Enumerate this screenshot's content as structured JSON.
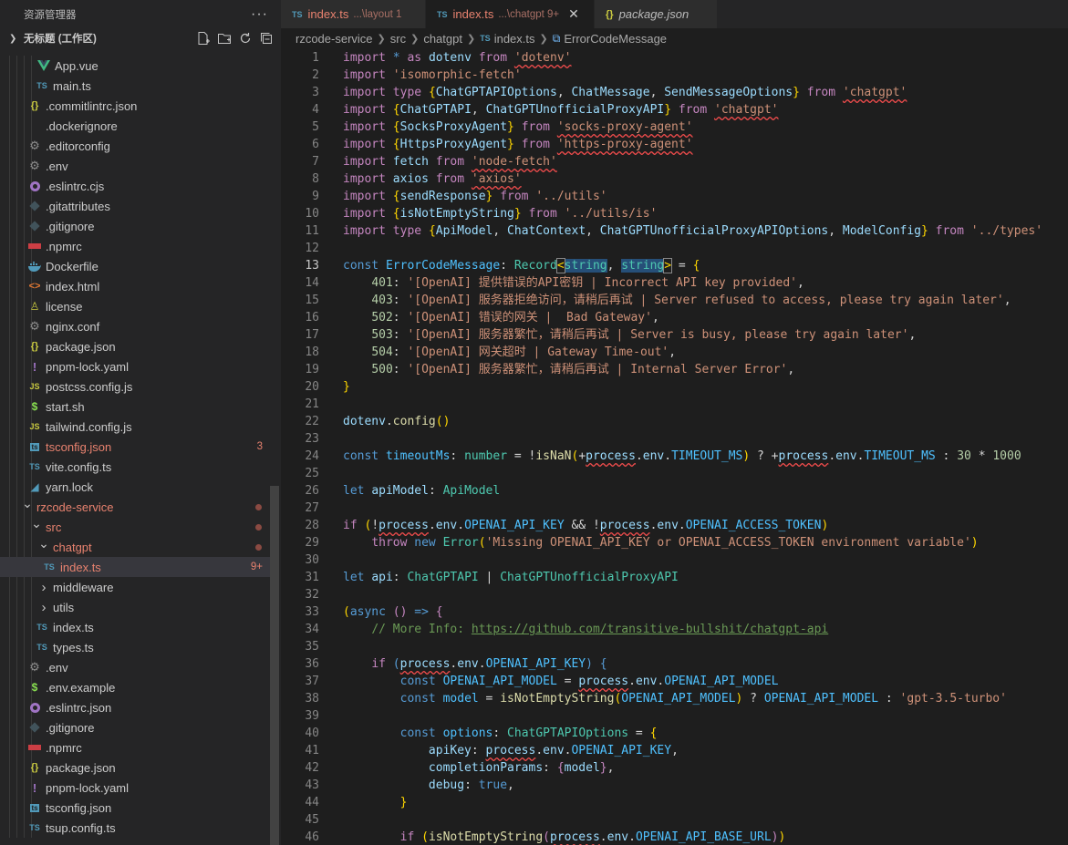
{
  "sidebar": {
    "header": "资源管理器",
    "more": "···",
    "workspace": "无标题 (工作区)",
    "items": [
      {
        "label": "App.vue",
        "icon": "vue",
        "color": "#41b883",
        "indent": 40
      },
      {
        "label": "main.ts",
        "icon": "ts",
        "color": "#519aba",
        "indent": 38
      },
      {
        "label": ".commitlintrc.json",
        "icon": "json",
        "color": "#cbcb41",
        "indent": 30
      },
      {
        "label": ".dockerignore",
        "icon": "none",
        "color": "#6d8086",
        "indent": 30
      },
      {
        "label": ".editorconfig",
        "icon": "gear",
        "color": "#8d8d8d",
        "indent": 30
      },
      {
        "label": ".env",
        "icon": "gear",
        "color": "#8d8d8d",
        "indent": 30
      },
      {
        "label": ".eslintrc.cjs",
        "icon": "circle",
        "color": "#a074c4",
        "indent": 30
      },
      {
        "label": ".gitattributes",
        "icon": "diamond",
        "color": "#41535b",
        "indent": 30
      },
      {
        "label": ".gitignore",
        "icon": "diamond",
        "color": "#41535b",
        "indent": 30
      },
      {
        "label": ".npmrc",
        "icon": "npm",
        "color": "#cc3e44",
        "indent": 30
      },
      {
        "label": "Dockerfile",
        "icon": "docker",
        "color": "#519aba",
        "indent": 30
      },
      {
        "label": "index.html",
        "icon": "html",
        "color": "#e37933",
        "indent": 30
      },
      {
        "label": "license",
        "icon": "license",
        "color": "#cbcb41",
        "indent": 30
      },
      {
        "label": "nginx.conf",
        "icon": "gear",
        "color": "#8d8d8d",
        "indent": 30
      },
      {
        "label": "package.json",
        "icon": "json",
        "color": "#cbcb41",
        "indent": 30
      },
      {
        "label": "pnpm-lock.yaml",
        "icon": "yaml",
        "color": "#a074c4",
        "indent": 30
      },
      {
        "label": "postcss.config.js",
        "icon": "js",
        "color": "#cbcb41",
        "indent": 30
      },
      {
        "label": "start.sh",
        "icon": "sh",
        "color": "#4d5a5e",
        "indent": 30
      },
      {
        "label": "tailwind.config.js",
        "icon": "js",
        "color": "#cbcb41",
        "indent": 30
      },
      {
        "label": "tsconfig.json",
        "icon": "tsconfig",
        "color": "#519aba",
        "indent": 30,
        "modified": true,
        "badge": "3"
      },
      {
        "label": "vite.config.ts",
        "icon": "ts",
        "color": "#519aba",
        "indent": 30
      },
      {
        "label": "yarn.lock",
        "icon": "yarn",
        "color": "#519aba",
        "indent": 30
      },
      {
        "label": "rzcode-service",
        "icon": "chevron-down",
        "indent": 22,
        "folder": true,
        "modified": true,
        "dot": true
      },
      {
        "label": "src",
        "icon": "chevron-down",
        "indent": 32,
        "folder": true,
        "modified": true,
        "dot": true
      },
      {
        "label": "chatgpt",
        "icon": "chevron-down",
        "indent": 40,
        "folder": true,
        "modified": true,
        "dot": true
      },
      {
        "label": "index.ts",
        "icon": "ts",
        "color": "#519aba",
        "indent": 46,
        "modified": true,
        "badge": "9+",
        "selected": true
      },
      {
        "label": "middleware",
        "icon": "chevron-right",
        "indent": 40,
        "folder": true
      },
      {
        "label": "utils",
        "icon": "chevron-right",
        "indent": 40,
        "folder": true
      },
      {
        "label": "index.ts",
        "icon": "ts",
        "color": "#519aba",
        "indent": 38
      },
      {
        "label": "types.ts",
        "icon": "ts",
        "color": "#519aba",
        "indent": 38
      },
      {
        "label": ".env",
        "icon": "gear",
        "color": "#8d8d8d",
        "indent": 30
      },
      {
        "label": ".env.example",
        "icon": "dollar",
        "color": "#89e051",
        "indent": 30
      },
      {
        "label": ".eslintrc.json",
        "icon": "circle",
        "color": "#a074c4",
        "indent": 30
      },
      {
        "label": ".gitignore",
        "icon": "diamond",
        "color": "#41535b",
        "indent": 30
      },
      {
        "label": ".npmrc",
        "icon": "npm",
        "color": "#cc3e44",
        "indent": 30
      },
      {
        "label": "package.json",
        "icon": "json",
        "color": "#cbcb41",
        "indent": 30
      },
      {
        "label": "pnpm-lock.yaml",
        "icon": "yaml",
        "color": "#a074c4",
        "indent": 30
      },
      {
        "label": "tsconfig.json",
        "icon": "tsconfig",
        "color": "#519aba",
        "indent": 30
      },
      {
        "label": "tsup.config.ts",
        "icon": "ts",
        "color": "#519aba",
        "indent": 30
      }
    ]
  },
  "tabs": [
    {
      "name": "index.ts",
      "desc": "...\\layout 1",
      "icon": "ts",
      "active": false
    },
    {
      "name": "index.ts",
      "desc": "...\\chatgpt 9+",
      "icon": "ts",
      "active": true,
      "close": "✕"
    },
    {
      "name": "package.json",
      "desc": "",
      "icon": "json",
      "active": false,
      "italic": true
    }
  ],
  "breadcrumb": [
    "rzcode-service",
    "src",
    "chatgpt",
    "index.ts",
    "ErrorCodeMessage"
  ],
  "editor": {
    "current_line": 13,
    "first_line": 1,
    "lines": [
      "<span class=\"c\">import</span> <span class=\"k\">*</span> <span class=\"c\">as</span> <span class=\"v\">dotenv</span> <span class=\"c\">from</span> <span class=\"s sq\">'dotenv'</span>",
      "<span class=\"c\">import</span> <span class=\"s\">'isomorphic-fetch'</span>",
      "<span class=\"c\">import</span> <span class=\"c\">type</span> <span class=\"br\">{</span><span class=\"v\">ChatGPTAPIOptions</span>, <span class=\"v\">ChatMessage</span>, <span class=\"v\">SendMessageOptions</span><span class=\"br\">}</span> <span class=\"c\">from</span> <span class=\"s sq\">'chatgpt'</span>",
      "<span class=\"c\">import</span> <span class=\"br\">{</span><span class=\"v\">ChatGPTAPI</span>, <span class=\"v\">ChatGPTUnofficialProxyAPI</span><span class=\"br\">}</span> <span class=\"c\">from</span> <span class=\"s sq\">'chatgpt'</span>",
      "<span class=\"c\">import</span> <span class=\"br\">{</span><span class=\"v\">SocksProxyAgent</span><span class=\"br\">}</span> <span class=\"c\">from</span> <span class=\"s sq\">'socks-proxy-agent'</span>",
      "<span class=\"c\">import</span> <span class=\"br\">{</span><span class=\"v\">HttpsProxyAgent</span><span class=\"br\">}</span> <span class=\"c\">from</span> <span class=\"s sq\">'https-proxy-agent'</span>",
      "<span class=\"c\">import</span> <span class=\"v\">fetch</span> <span class=\"c\">from</span> <span class=\"s sq\">'node-fetch'</span>",
      "<span class=\"c\">import</span> <span class=\"v\">axios</span> <span class=\"c\">from</span> <span class=\"s sq\">'axios'</span>",
      "<span class=\"c\">import</span> <span class=\"br\">{</span><span class=\"v\">sendResponse</span><span class=\"br\">}</span> <span class=\"c\">from</span> <span class=\"s\">'../utils'</span>",
      "<span class=\"c\">import</span> <span class=\"br\">{</span><span class=\"v\">isNotEmptyString</span><span class=\"br\">}</span> <span class=\"c\">from</span> <span class=\"s\">'../utils/is'</span>",
      "<span class=\"c\">import</span> <span class=\"c\">type</span> <span class=\"br\">{</span><span class=\"v\">ApiModel</span>, <span class=\"v\">ChatContext</span>, <span class=\"v\">ChatGPTUnofficialProxyAPIOptions</span>, <span class=\"v\">ModelConfig</span><span class=\"br\">}</span> <span class=\"c\">from</span> <span class=\"s\">'../types'</span>",
      "",
      "<span class=\"k\">const</span> <span class=\"cst\">ErrorCodeMessage</span>: <span class=\"t\">Record</span><span class=\"br bm\">&lt;</span><span class=\"t hl\">string</span>, <span class=\"t hl\">string</span><span class=\"br bm\">&gt;</span> = <span class=\"br\">{</span>",
      "    <span class=\"n\">401</span>: <span class=\"s\">'[OpenAI] 提供错误的API密钥 | Incorrect API key provided'</span>,",
      "    <span class=\"n\">403</span>: <span class=\"s\">'[OpenAI] 服务器拒绝访问，请稍后再试 | Server refused to access, please try again later'</span>,",
      "    <span class=\"n\">502</span>: <span class=\"s\">'[OpenAI] 错误的网关 |  Bad Gateway'</span>,",
      "    <span class=\"n\">503</span>: <span class=\"s\">'[OpenAI] 服务器繁忙，请稍后再试 | Server is busy, please try again later'</span>,",
      "    <span class=\"n\">504</span>: <span class=\"s\">'[OpenAI] 网关超时 | Gateway Time-out'</span>,",
      "    <span class=\"n\">500</span>: <span class=\"s\">'[OpenAI] 服务器繁忙，请稍后再试 | Internal Server Error'</span>,",
      "<span class=\"br\">}</span>",
      "",
      "<span class=\"v\">dotenv</span>.<span class=\"f\">config</span><span class=\"br\">()</span>",
      "",
      "<span class=\"k\">const</span> <span class=\"cst\">timeoutMs</span>: <span class=\"t\">number</span> = !<span class=\"f\">isNaN</span><span class=\"br\">(</span>+<span class=\"v sq\">process</span>.<span class=\"v\">env</span>.<span class=\"cst\">TIMEOUT_MS</span><span class=\"br\">)</span> ? +<span class=\"v sq\">process</span>.<span class=\"v\">env</span>.<span class=\"cst\">TIMEOUT_MS</span> : <span class=\"n\">30</span> * <span class=\"n\">1000</span>",
      "",
      "<span class=\"k\">let</span> <span class=\"v\">apiModel</span>: <span class=\"t\">ApiModel</span>",
      "",
      "<span class=\"c\">if</span> <span class=\"br\">(</span>!<span class=\"v sq\">process</span>.<span class=\"v\">env</span>.<span class=\"cst\">OPENAI_API_KEY</span> &amp;&amp; !<span class=\"v sq\">process</span>.<span class=\"v\">env</span>.<span class=\"cst\">OPENAI_ACCESS_TOKEN</span><span class=\"br\">)</span>",
      "    <span class=\"c\">throw</span> <span class=\"k\">new</span> <span class=\"t\">Error</span><span class=\"br\">(</span><span class=\"s\">'Missing OPENAI_API_KEY or OPENAI_ACCESS_TOKEN environment variable'</span><span class=\"br\">)</span>",
      "",
      "<span class=\"k\">let</span> <span class=\"v\">api</span>: <span class=\"t\">ChatGPTAPI</span> | <span class=\"t\">ChatGPTUnofficialProxyAPI</span>",
      "",
      "<span class=\"br\">(</span><span class=\"k\">async</span> <span class=\"c\">()</span> <span class=\"k\">=&gt;</span> <span class=\"c\">{</span>",
      "    <span class=\"cm\">// More Info: <span class=\"ul\">https://github.com/transitive-bullshit/chatgpt-api</span></span>",
      "",
      "    <span class=\"c\">if</span> <span class=\"k\">(</span><span class=\"v sq\">process</span>.<span class=\"v\">env</span>.<span class=\"cst\">OPENAI_API_KEY</span><span class=\"k\">)</span> <span class=\"k\">{</span>",
      "        <span class=\"k\">const</span> <span class=\"cst\">OPENAI_API_MODEL</span> = <span class=\"v sq\">process</span>.<span class=\"v\">env</span>.<span class=\"cst\">OPENAI_API_MODEL</span>",
      "        <span class=\"k\">const</span> <span class=\"cst\">model</span> = <span class=\"f\">isNotEmptyString</span><span class=\"br\">(</span><span class=\"cst\">OPENAI_API_MODEL</span><span class=\"br\">)</span> ? <span class=\"cst\">OPENAI_API_MODEL</span> : <span class=\"s\">'gpt-3.5-turbo'</span>",
      "",
      "        <span class=\"k\">const</span> <span class=\"cst\">options</span>: <span class=\"t\">ChatGPTAPIOptions</span> = <span class=\"br\">{</span>",
      "            <span class=\"v\">apiKey</span>: <span class=\"v sq\">process</span>.<span class=\"v\">env</span>.<span class=\"cst\">OPENAI_API_KEY</span>,",
      "            <span class=\"v\">completionParams</span>: <span class=\"c\">{</span><span class=\"v\">model</span><span class=\"c\">}</span>,",
      "            <span class=\"v\">debug</span>: <span class=\"k\">true</span>,",
      "        <span class=\"br\">}</span>",
      "",
      "        <span class=\"c\">if</span> <span class=\"br\">(</span><span class=\"f\">isNotEmptyString</span><span class=\"c\">(</span><span class=\"v sq\">process</span>.<span class=\"v\">env</span>.<span class=\"cst\">OPENAI_API_BASE_URL</span><span class=\"c\">)</span><span class=\"br\">)</span>"
    ]
  }
}
